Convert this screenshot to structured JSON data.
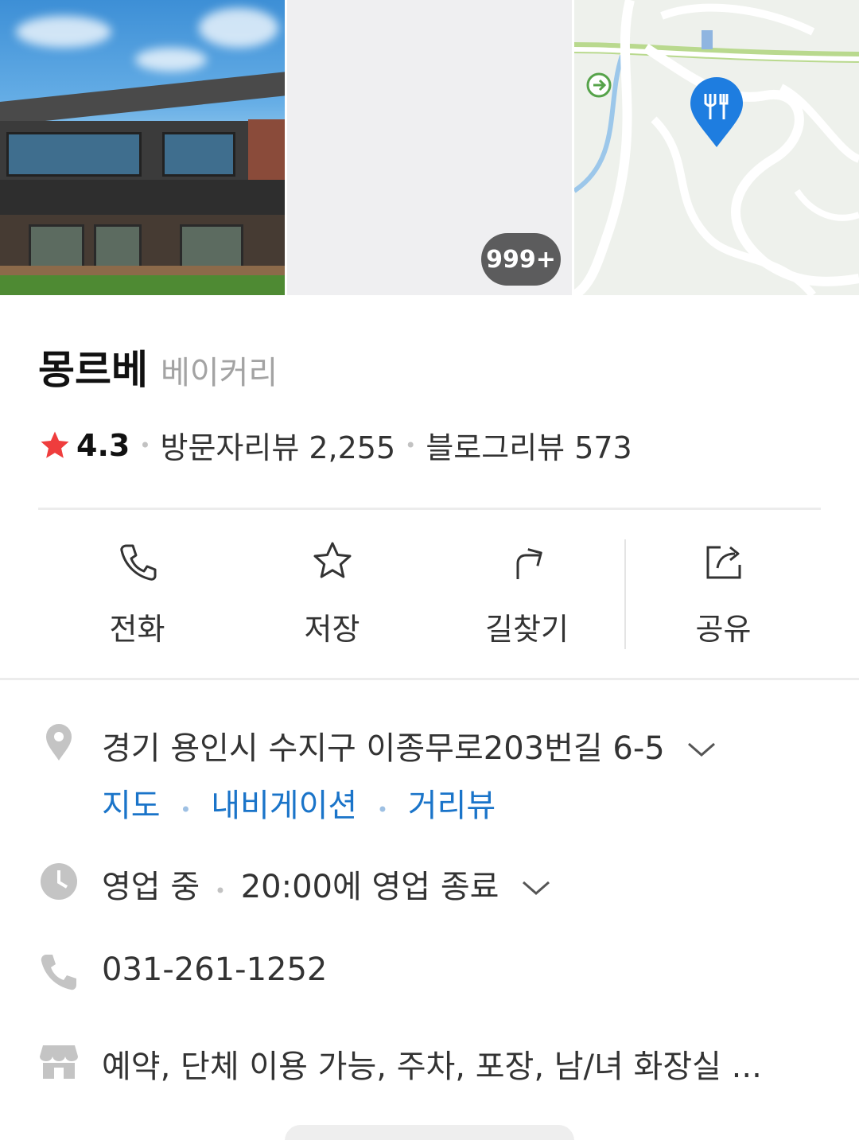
{
  "gallery": {
    "photo_count_badge": "999+"
  },
  "place": {
    "name": "몽르베",
    "category": "베이커리",
    "rating": "4.3",
    "visitor_reviews": "방문자리뷰 2,255",
    "blog_reviews": "블로그리뷰 573",
    "accent_color": "#ef3d3d"
  },
  "actions": [
    {
      "label": "전화",
      "icon": "phone-icon"
    },
    {
      "label": "저장",
      "icon": "star-outline-icon"
    },
    {
      "label": "길찾기",
      "icon": "directions-icon"
    },
    {
      "label": "공유",
      "icon": "share-icon"
    }
  ],
  "info": {
    "address": "경기 용인시 수지구 이종무로203번길 6-5",
    "address_links": [
      "지도",
      "내비게이션",
      "거리뷰"
    ],
    "hours_status": "영업 중",
    "hours_detail": "20:00에 영업 종료",
    "phone": "031-261-1252",
    "amenities": "예약, 단체 이용 가능, 주차, 포장, 남/녀 화장실 ...",
    "link_color": "#1a74c9"
  }
}
